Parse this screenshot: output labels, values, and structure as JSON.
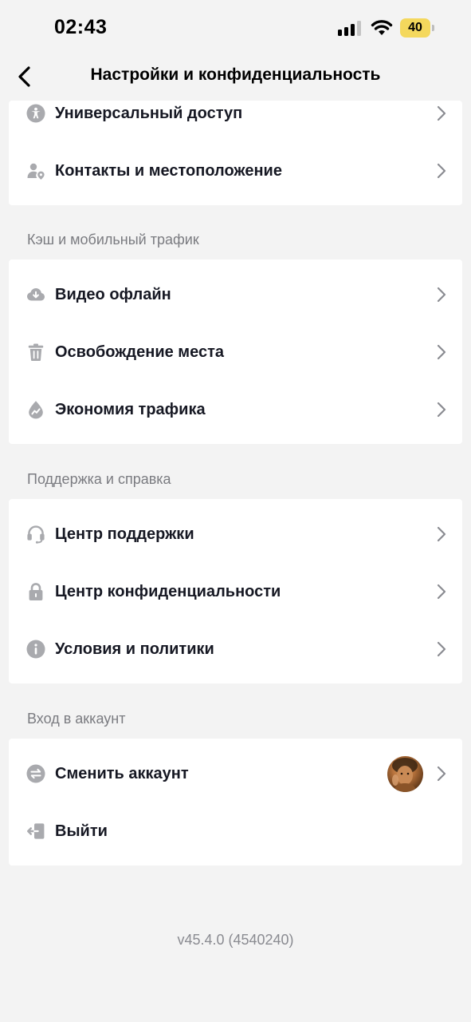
{
  "status_bar": {
    "time": "02:43",
    "battery_level": "40",
    "battery_color": "#f4d85d"
  },
  "header": {
    "title": "Настройки и конфиденциальность",
    "back_icon": "chevron-left-icon"
  },
  "top_group": {
    "items": [
      {
        "label": "Универсальный доступ",
        "icon": "accessibility-icon"
      },
      {
        "label": "Контакты и местоположение",
        "icon": "contacts-location-icon"
      }
    ]
  },
  "cache_section": {
    "title": "Кэш и мобильный трафик",
    "items": [
      {
        "label": "Видео офлайн",
        "icon": "cloud-download-icon"
      },
      {
        "label": "Освобождение места",
        "icon": "trash-icon"
      },
      {
        "label": "Экономия трафика",
        "icon": "data-saver-icon"
      }
    ]
  },
  "support_section": {
    "title": "Поддержка и справка",
    "items": [
      {
        "label": "Центр поддержки",
        "icon": "headset-icon"
      },
      {
        "label": "Центр конфиденциальности",
        "icon": "lock-icon"
      },
      {
        "label": "Условия и политики",
        "icon": "info-icon"
      }
    ]
  },
  "account_section": {
    "title": "Вход в аккаунт",
    "items": [
      {
        "label": "Сменить аккаунт",
        "icon": "switch-account-icon"
      },
      {
        "label": "Выйти",
        "icon": "logout-icon"
      }
    ]
  },
  "footer": {
    "version": "v45.4.0 (4540240)"
  },
  "colors": {
    "background": "#f3f3f3",
    "card": "#ffffff",
    "icon_gray": "#a9aaae",
    "text": "#161823",
    "section_text": "#7a7b80"
  }
}
